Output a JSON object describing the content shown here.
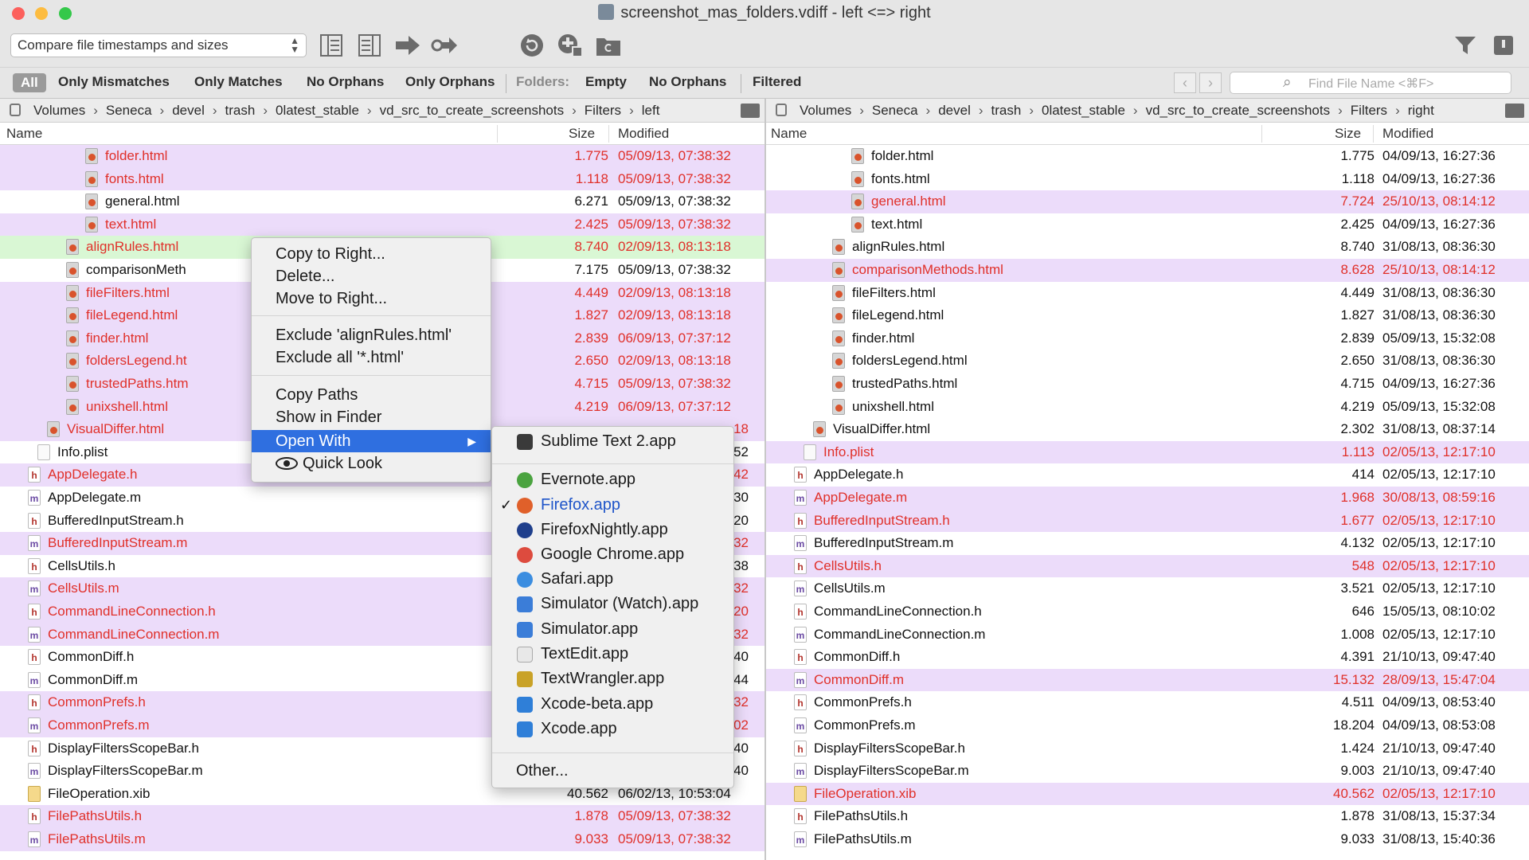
{
  "window": {
    "title": "screenshot_mas_folders.vdiff - left <=> right"
  },
  "toolbar": {
    "compare_mode": "Compare file timestamps and sizes",
    "icons": [
      "left-panel-icon",
      "right-panel-icon",
      "arrow-right-icon",
      "key-arrow-icon",
      "refresh-icon",
      "sync-icon",
      "folder-icon",
      "filter-icon",
      "sidebar-icon"
    ]
  },
  "filters": {
    "all": "All",
    "only_mismatches": "Only Mismatches",
    "only_matches": "Only Matches",
    "no_orphans": "No Orphans",
    "only_orphans": "Only Orphans",
    "folders_label": "Folders:",
    "empty": "Empty",
    "folder_no_orphans": "No Orphans",
    "filtered": "Filtered",
    "search_placeholder": "Find File Name <⌘F>"
  },
  "colors": {
    "mismatch_text": "#e0302a",
    "mismatch_bg": "#ecdcfa",
    "selected_bg": "#d9f7d4",
    "normal_text": "#111111",
    "menu_highlight": "#2f6fe0"
  },
  "left": {
    "path": [
      "Volumes",
      "Seneca",
      "devel",
      "trash",
      "0latest_stable",
      "vd_src_to_create_screenshots",
      "Filters",
      "left"
    ],
    "columns": {
      "name": "Name",
      "size": "Size",
      "modified": "Modified"
    },
    "rows": [
      {
        "name": "folder.html",
        "size": "1.775",
        "date": "05/09/13, 07:38:32",
        "icon": "html",
        "depth": 3,
        "status": "mismatch"
      },
      {
        "name": "fonts.html",
        "size": "1.118",
        "date": "05/09/13, 07:38:32",
        "icon": "html",
        "depth": 3,
        "status": "mismatch"
      },
      {
        "name": "general.html",
        "size": "6.271",
        "date": "05/09/13, 07:38:32",
        "icon": "html",
        "depth": 3,
        "status": "same"
      },
      {
        "name": "text.html",
        "size": "2.425",
        "date": "05/09/13, 07:38:32",
        "icon": "html",
        "depth": 3,
        "status": "mismatch"
      },
      {
        "name": "alignRules.html",
        "size": "8.740",
        "date": "02/09/13, 08:13:18",
        "icon": "html",
        "depth": 2,
        "status": "selected"
      },
      {
        "name": "comparisonMeth",
        "size": "7.175",
        "date": "05/09/13, 07:38:32",
        "icon": "html",
        "depth": 2,
        "status": "same"
      },
      {
        "name": "fileFilters.html",
        "size": "4.449",
        "date": "02/09/13, 08:13:18",
        "icon": "html",
        "depth": 2,
        "status": "mismatch"
      },
      {
        "name": "fileLegend.html",
        "size": "1.827",
        "date": "02/09/13, 08:13:18",
        "icon": "html",
        "depth": 2,
        "status": "mismatch"
      },
      {
        "name": "finder.html",
        "size": "2.839",
        "date": "06/09/13, 07:37:12",
        "icon": "html",
        "depth": 2,
        "status": "mismatch"
      },
      {
        "name": "foldersLegend.ht",
        "size": "2.650",
        "date": "02/09/13, 08:13:18",
        "icon": "html",
        "depth": 2,
        "status": "mismatch"
      },
      {
        "name": "trustedPaths.htm",
        "size": "4.715",
        "date": "05/09/13, 07:38:32",
        "icon": "html",
        "depth": 2,
        "status": "mismatch"
      },
      {
        "name": "unixshell.html",
        "size": "4.219",
        "date": "06/09/13, 07:37:12",
        "icon": "html",
        "depth": 2,
        "status": "mismatch"
      },
      {
        "name": "VisualDiffer.html",
        "size": "",
        "date": "18",
        "icon": "html",
        "depth": 1,
        "status": "mismatch"
      },
      {
        "name": "Info.plist",
        "size": "",
        "date": "52",
        "icon": "plist",
        "depth": 0.5,
        "status": "same"
      },
      {
        "name": "AppDelegate.h",
        "size": "",
        "date": "42",
        "icon": "h",
        "depth": 0,
        "status": "mismatch"
      },
      {
        "name": "AppDelegate.m",
        "size": "",
        "date": "30",
        "icon": "m",
        "depth": 0,
        "status": "same"
      },
      {
        "name": "BufferedInputStream.h",
        "size": "",
        "date": "20",
        "icon": "h",
        "depth": 0,
        "status": "same"
      },
      {
        "name": "BufferedInputStream.m",
        "size": "",
        "date": "32",
        "icon": "m",
        "depth": 0,
        "status": "mismatch"
      },
      {
        "name": "CellsUtils.h",
        "size": "",
        "date": "38",
        "icon": "h",
        "depth": 0,
        "status": "same"
      },
      {
        "name": "CellsUtils.m",
        "size": "",
        "date": "32",
        "icon": "m",
        "depth": 0,
        "status": "mismatch"
      },
      {
        "name": "CommandLineConnection.h",
        "size": "",
        "date": "20",
        "icon": "h",
        "depth": 0,
        "status": "mismatch"
      },
      {
        "name": "CommandLineConnection.m",
        "size": "",
        "date": "32",
        "icon": "m",
        "depth": 0,
        "status": "mismatch"
      },
      {
        "name": "CommonDiff.h",
        "size": "",
        "date": "40",
        "icon": "h",
        "depth": 0,
        "status": "same"
      },
      {
        "name": "CommonDiff.m",
        "size": "",
        "date": "44",
        "icon": "m",
        "depth": 0,
        "status": "same"
      },
      {
        "name": "CommonPrefs.h",
        "size": "",
        "date": "32",
        "icon": "h",
        "depth": 0,
        "status": "mismatch"
      },
      {
        "name": "CommonPrefs.m",
        "size": "",
        "date": "02",
        "icon": "m",
        "depth": 0,
        "status": "mismatch"
      },
      {
        "name": "DisplayFiltersScopeBar.h",
        "size": "",
        "date": "40",
        "icon": "h",
        "depth": 0,
        "status": "same"
      },
      {
        "name": "DisplayFiltersScopeBar.m",
        "size": "",
        "date": "40",
        "icon": "m",
        "depth": 0,
        "status": "same"
      },
      {
        "name": "FileOperation.xib",
        "size": "40.562",
        "date": "06/02/13, 10:53:04",
        "icon": "xib",
        "depth": 0,
        "status": "same"
      },
      {
        "name": "FilePathsUtils.h",
        "size": "1.878",
        "date": "05/09/13, 07:38:32",
        "icon": "h",
        "depth": 0,
        "status": "mismatch"
      },
      {
        "name": "FilePathsUtils.m",
        "size": "9.033",
        "date": "05/09/13, 07:38:32",
        "icon": "m",
        "depth": 0,
        "status": "mismatch"
      }
    ]
  },
  "right": {
    "path": [
      "Volumes",
      "Seneca",
      "devel",
      "trash",
      "0latest_stable",
      "vd_src_to_create_screenshots",
      "Filters",
      "right"
    ],
    "columns": {
      "name": "Name",
      "size": "Size",
      "modified": "Modified"
    },
    "rows": [
      {
        "name": "folder.html",
        "size": "1.775",
        "date": "04/09/13, 16:27:36",
        "icon": "html",
        "depth": 3,
        "status": "same"
      },
      {
        "name": "fonts.html",
        "size": "1.118",
        "date": "04/09/13, 16:27:36",
        "icon": "html",
        "depth": 3,
        "status": "same"
      },
      {
        "name": "general.html",
        "size": "7.724",
        "date": "25/10/13, 08:14:12",
        "icon": "html",
        "depth": 3,
        "status": "mismatch"
      },
      {
        "name": "text.html",
        "size": "2.425",
        "date": "04/09/13, 16:27:36",
        "icon": "html",
        "depth": 3,
        "status": "same"
      },
      {
        "name": "alignRules.html",
        "size": "8.740",
        "date": "31/08/13, 08:36:30",
        "icon": "html",
        "depth": 2,
        "status": "same"
      },
      {
        "name": "comparisonMethods.html",
        "size": "8.628",
        "date": "25/10/13, 08:14:12",
        "icon": "html",
        "depth": 2,
        "status": "mismatch"
      },
      {
        "name": "fileFilters.html",
        "size": "4.449",
        "date": "31/08/13, 08:36:30",
        "icon": "html",
        "depth": 2,
        "status": "same"
      },
      {
        "name": "fileLegend.html",
        "size": "1.827",
        "date": "31/08/13, 08:36:30",
        "icon": "html",
        "depth": 2,
        "status": "same"
      },
      {
        "name": "finder.html",
        "size": "2.839",
        "date": "05/09/13, 15:32:08",
        "icon": "html",
        "depth": 2,
        "status": "same"
      },
      {
        "name": "foldersLegend.html",
        "size": "2.650",
        "date": "31/08/13, 08:36:30",
        "icon": "html",
        "depth": 2,
        "status": "same"
      },
      {
        "name": "trustedPaths.html",
        "size": "4.715",
        "date": "04/09/13, 16:27:36",
        "icon": "html",
        "depth": 2,
        "status": "same"
      },
      {
        "name": "unixshell.html",
        "size": "4.219",
        "date": "05/09/13, 15:32:08",
        "icon": "html",
        "depth": 2,
        "status": "same"
      },
      {
        "name": "VisualDiffer.html",
        "size": "2.302",
        "date": "31/08/13, 08:37:14",
        "icon": "html",
        "depth": 1,
        "status": "same"
      },
      {
        "name": "Info.plist",
        "size": "1.113",
        "date": "02/05/13, 12:17:10",
        "icon": "plist",
        "depth": 0.5,
        "status": "mismatch"
      },
      {
        "name": "AppDelegate.h",
        "size": "414",
        "date": "02/05/13, 12:17:10",
        "icon": "h",
        "depth": 0,
        "status": "same"
      },
      {
        "name": "AppDelegate.m",
        "size": "1.968",
        "date": "30/08/13, 08:59:16",
        "icon": "m",
        "depth": 0,
        "status": "mismatch"
      },
      {
        "name": "BufferedInputStream.h",
        "size": "1.677",
        "date": "02/05/13, 12:17:10",
        "icon": "h",
        "depth": 0,
        "status": "mismatch"
      },
      {
        "name": "BufferedInputStream.m",
        "size": "4.132",
        "date": "02/05/13, 12:17:10",
        "icon": "m",
        "depth": 0,
        "status": "same"
      },
      {
        "name": "CellsUtils.h",
        "size": "548",
        "date": "02/05/13, 12:17:10",
        "icon": "h",
        "depth": 0,
        "status": "mismatch"
      },
      {
        "name": "CellsUtils.m",
        "size": "3.521",
        "date": "02/05/13, 12:17:10",
        "icon": "m",
        "depth": 0,
        "status": "same"
      },
      {
        "name": "CommandLineConnection.h",
        "size": "646",
        "date": "15/05/13, 08:10:02",
        "icon": "h",
        "depth": 0,
        "status": "same"
      },
      {
        "name": "CommandLineConnection.m",
        "size": "1.008",
        "date": "02/05/13, 12:17:10",
        "icon": "m",
        "depth": 0,
        "status": "same"
      },
      {
        "name": "CommonDiff.h",
        "size": "4.391",
        "date": "21/10/13, 09:47:40",
        "icon": "h",
        "depth": 0,
        "status": "same"
      },
      {
        "name": "CommonDiff.m",
        "size": "15.132",
        "date": "28/09/13, 15:47:04",
        "icon": "m",
        "depth": 0,
        "status": "mismatch"
      },
      {
        "name": "CommonPrefs.h",
        "size": "4.511",
        "date": "04/09/13, 08:53:40",
        "icon": "h",
        "depth": 0,
        "status": "same"
      },
      {
        "name": "CommonPrefs.m",
        "size": "18.204",
        "date": "04/09/13, 08:53:08",
        "icon": "m",
        "depth": 0,
        "status": "same"
      },
      {
        "name": "DisplayFiltersScopeBar.h",
        "size": "1.424",
        "date": "21/10/13, 09:47:40",
        "icon": "h",
        "depth": 0,
        "status": "same"
      },
      {
        "name": "DisplayFiltersScopeBar.m",
        "size": "9.003",
        "date": "21/10/13, 09:47:40",
        "icon": "m",
        "depth": 0,
        "status": "same"
      },
      {
        "name": "FileOperation.xib",
        "size": "40.562",
        "date": "02/05/13, 12:17:10",
        "icon": "xib",
        "depth": 0,
        "status": "mismatch"
      },
      {
        "name": "FilePathsUtils.h",
        "size": "1.878",
        "date": "31/08/13, 15:37:34",
        "icon": "h",
        "depth": 0,
        "status": "same"
      },
      {
        "name": "FilePathsUtils.m",
        "size": "9.033",
        "date": "31/08/13, 15:40:36",
        "icon": "m",
        "depth": 0,
        "status": "same"
      }
    ]
  },
  "context_menu": {
    "copy_to_right": "Copy to Right...",
    "delete": "Delete...",
    "move_to_right": "Move to Right...",
    "exclude_file": "Exclude 'alignRules.html'",
    "exclude_all": "Exclude all '*.html'",
    "copy_paths": "Copy Paths",
    "show_in_finder": "Show in Finder",
    "open_with": "Open With",
    "quick_look": "Quick Look"
  },
  "open_with_menu": {
    "apps": [
      {
        "label": "Sublime Text 2.app",
        "icon": "sublime-icon",
        "color": "#3a3a3a",
        "checked": false
      },
      {
        "label": "Evernote.app",
        "icon": "evernote-icon",
        "color": "#4aa33f",
        "checked": false
      },
      {
        "label": "Firefox.app",
        "icon": "firefox-icon",
        "color": "#e0602a",
        "checked": true
      },
      {
        "label": "FirefoxNightly.app",
        "icon": "firefox-nightly-icon",
        "color": "#1f3f8c",
        "checked": false
      },
      {
        "label": "Google Chrome.app",
        "icon": "chrome-icon",
        "color": "#dd4b3e",
        "checked": false
      },
      {
        "label": "Safari.app",
        "icon": "safari-icon",
        "color": "#3b8de0",
        "checked": false
      },
      {
        "label": "Simulator (Watch).app",
        "icon": "simulator-watch-icon",
        "color": "#3b7dd8",
        "checked": false
      },
      {
        "label": "Simulator.app",
        "icon": "simulator-icon",
        "color": "#3b7dd8",
        "checked": false
      },
      {
        "label": "TextEdit.app",
        "icon": "textedit-icon",
        "color": "#e8e8e8",
        "checked": false
      },
      {
        "label": "TextWrangler.app",
        "icon": "textwrangler-icon",
        "color": "#c9a227",
        "checked": false
      },
      {
        "label": "Xcode-beta.app",
        "icon": "xcode-beta-icon",
        "color": "#2f7fd8",
        "checked": false
      },
      {
        "label": "Xcode.app",
        "icon": "xcode-icon",
        "color": "#2f7fd8",
        "checked": false
      }
    ],
    "other": "Other..."
  }
}
